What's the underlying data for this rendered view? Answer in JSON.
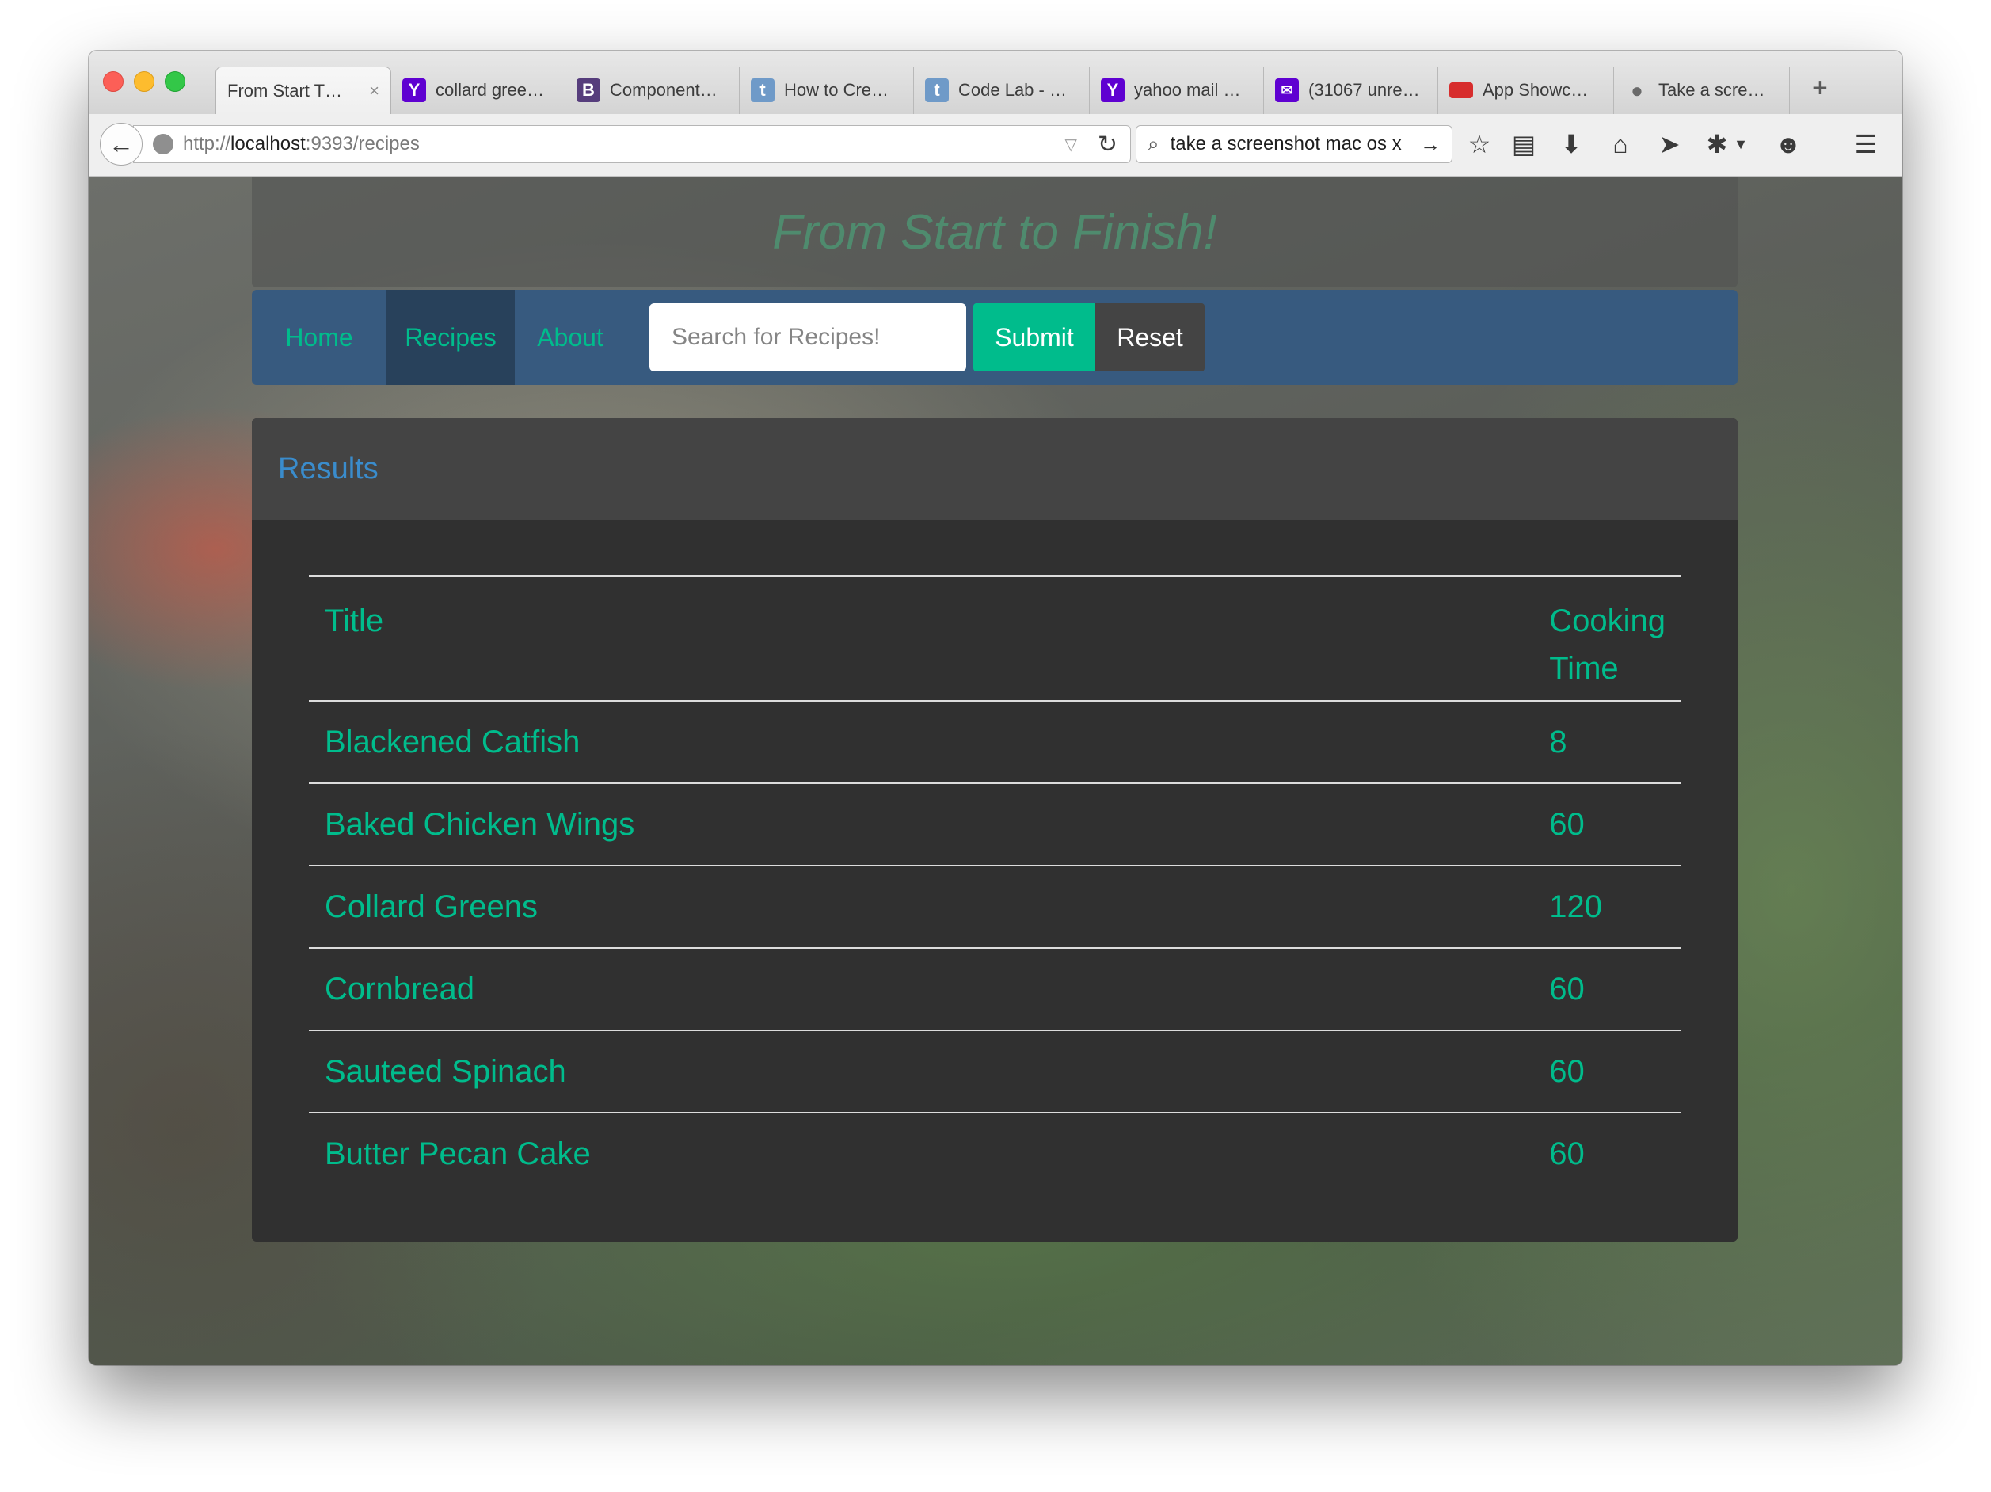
{
  "browser": {
    "tabs": [
      {
        "label": "From Start T…",
        "favicon": "blank",
        "color": "#ffffff",
        "active": true
      },
      {
        "label": "collard gree…",
        "favicon": "Y",
        "color": "#5f01d1"
      },
      {
        "label": "Component…",
        "favicon": "B",
        "color": "#563d7c"
      },
      {
        "label": "How to Cre…",
        "favicon": "t",
        "color": "#6f9ac8"
      },
      {
        "label": "Code Lab - …",
        "favicon": "t",
        "color": "#6f9ac8"
      },
      {
        "label": "yahoo mail …",
        "favicon": "Y",
        "color": "#5f01d1"
      },
      {
        "label": "(31067 unre…",
        "favicon": "mail",
        "color": "#5f01d1"
      },
      {
        "label": "App Showc…",
        "favicon": "shop",
        "color": "#d72d2d"
      },
      {
        "label": "Take a scre…",
        "favicon": "apple",
        "color": "#777777"
      }
    ],
    "close_icon": "×",
    "new_tab": "+",
    "url": {
      "prefix": "http://",
      "host": "localhost",
      "rest": ":9393/recipes"
    },
    "search_text": "take a screenshot mac os x"
  },
  "site": {
    "title": "From Start to Finish!",
    "nav": {
      "home": "Home",
      "recipes": "Recipes",
      "about": "About"
    },
    "search_placeholder": "Search for Recipes!",
    "submit_label": "Submit",
    "reset_label": "Reset"
  },
  "results": {
    "heading": "Results",
    "columns": [
      "Title",
      "Cooking Time"
    ],
    "rows": [
      {
        "title": "Blackened Catfish",
        "time": "8"
      },
      {
        "title": "Baked Chicken Wings",
        "time": "60"
      },
      {
        "title": "Collard Greens",
        "time": "120"
      },
      {
        "title": "Cornbread",
        "time": "60"
      },
      {
        "title": "Sauteed Spinach",
        "time": "60"
      },
      {
        "title": "Butter Pecan Cake",
        "time": "60"
      }
    ]
  },
  "colors": {
    "accent": "#00bc8c",
    "navbar": "#375a7f",
    "panel": "#303030",
    "link_blue": "#3a8ccc"
  }
}
